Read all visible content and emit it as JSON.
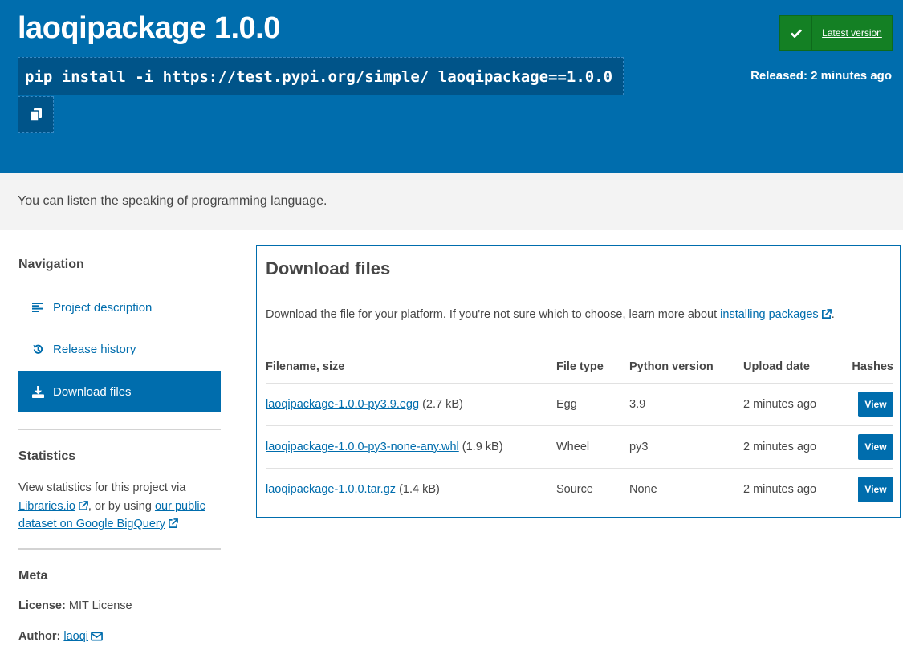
{
  "header": {
    "title": "laoqipackage 1.0.0",
    "pip_command": "pip install -i https://test.pypi.org/simple/ laoqipackage==1.0.0",
    "latest_version_label": "Latest version",
    "released": "Released: 2 minutes ago"
  },
  "summary": "You can listen the speaking of programming language.",
  "sidebar": {
    "navigation_heading": "Navigation",
    "nav_items": [
      {
        "label": "Project description",
        "icon": "align-left-icon"
      },
      {
        "label": "Release history",
        "icon": "history-icon"
      },
      {
        "label": "Download files",
        "icon": "download-icon",
        "active": true
      }
    ],
    "statistics_heading": "Statistics",
    "statistics_text_1": "View statistics for this project via",
    "statistics_link_1": "Libraries.io",
    "statistics_text_2": ", or by using",
    "statistics_link_2": "our public dataset on Google BigQuery",
    "meta_heading": "Meta",
    "license_label": "License:",
    "license_value": "MIT License",
    "author_label": "Author:",
    "author_value": "laoqi"
  },
  "downloads": {
    "heading": "Download files",
    "intro": "Download the file for your platform. If you're not sure which to choose, learn more about",
    "intro_link": "installing packages",
    "intro_end": ".",
    "columns": [
      "Filename, size",
      "File type",
      "Python version",
      "Upload date",
      "Hashes"
    ],
    "rows": [
      {
        "filename": "laoqipackage-1.0.0-py3.9.egg",
        "size": "(2.7 kB)",
        "type": "Egg",
        "python": "3.9",
        "date": "2 minutes ago",
        "hash_label": "View"
      },
      {
        "filename": "laoqipackage-1.0.0-py3-none-any.whl",
        "size": "(1.9 kB)",
        "type": "Wheel",
        "python": "py3",
        "date": "2 minutes ago",
        "hash_label": "View"
      },
      {
        "filename": "laoqipackage-1.0.0.tar.gz",
        "size": "(1.4 kB)",
        "type": "Source",
        "python": "None",
        "date": "2 minutes ago",
        "hash_label": "View"
      }
    ]
  },
  "colors": {
    "brand_blue": "#006dad",
    "latest_green": "#148024"
  }
}
